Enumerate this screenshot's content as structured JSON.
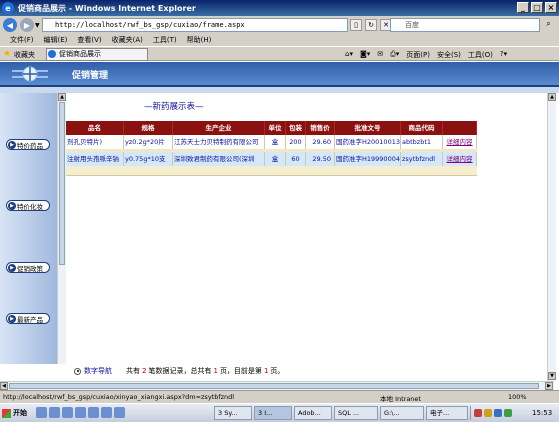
{
  "window": {
    "title": "促销商品展示 - Windows Internet Explorer",
    "controls": [
      "_",
      "□",
      "×"
    ]
  },
  "address": {
    "url": "http://localhost/rwf_bs_gsp/cuxiao/frame.aspx",
    "search_placeholder": "百度"
  },
  "menu": [
    "文件(F)",
    "编辑(E)",
    "查看(V)",
    "收藏夹(A)",
    "工具(T)",
    "帮助(H)"
  ],
  "favorites": {
    "label": "收藏夹",
    "tab_title": "促销商品展示",
    "command_tools": [
      "页面(P)",
      "安全(S)",
      "工具(O)"
    ]
  },
  "header": {
    "title": "促销管理"
  },
  "sidebar": {
    "items": [
      {
        "label": "特价药品"
      },
      {
        "label": "特价化妆"
      },
      {
        "label": "促销政策"
      },
      {
        "label": "最新产品"
      }
    ]
  },
  "main": {
    "list_title": "—新药展示表—",
    "columns": [
      "品名",
      "规格",
      "生产企业",
      "单位",
      "包装",
      "销售价",
      "批准文号",
      "商品代码",
      ""
    ],
    "rows": [
      {
        "name": "剂孔贝特片)",
        "spec": "yz0.2g*20片",
        "maker": "江苏天士力贝特制药有限公司",
        "unit": "盒",
        "pack": "200",
        "price": "29.60",
        "approval": "国药准字H20010013",
        "code": "abtbzbt1",
        "action": "详细内容"
      },
      {
        "name": "注射用头孢哌辛钠",
        "spec": "y0.75g*10支",
        "maker": "深圳致君制药有限公司(深圳",
        "unit": "盒",
        "pack": "60",
        "price": "29.50",
        "approval": "国药准字H19990004",
        "code": "zsytbfzndl",
        "action": "详细内容"
      }
    ],
    "pager": {
      "nav_label": "数字导航",
      "prefix": "共有",
      "record_count": "2",
      "mid": "笔数据记录，总共有",
      "page_total": "1",
      "mid2": "页，目前是第",
      "page_current": "1",
      "suffix": "页。"
    }
  },
  "status": {
    "url": "http://localhost/rwf_bs_gsp/cuxiao/xinyao_xiangxi.aspx?dm=zsytbfzndl",
    "zone": "本地 Intranet",
    "zoom": "100%"
  },
  "taskbar": {
    "start": "开始",
    "tasks": [
      "3 Sy...",
      "3 I...",
      "Adob...",
      "SQL ...",
      "G:\\...",
      "电子..."
    ],
    "clock": "15:53"
  }
}
